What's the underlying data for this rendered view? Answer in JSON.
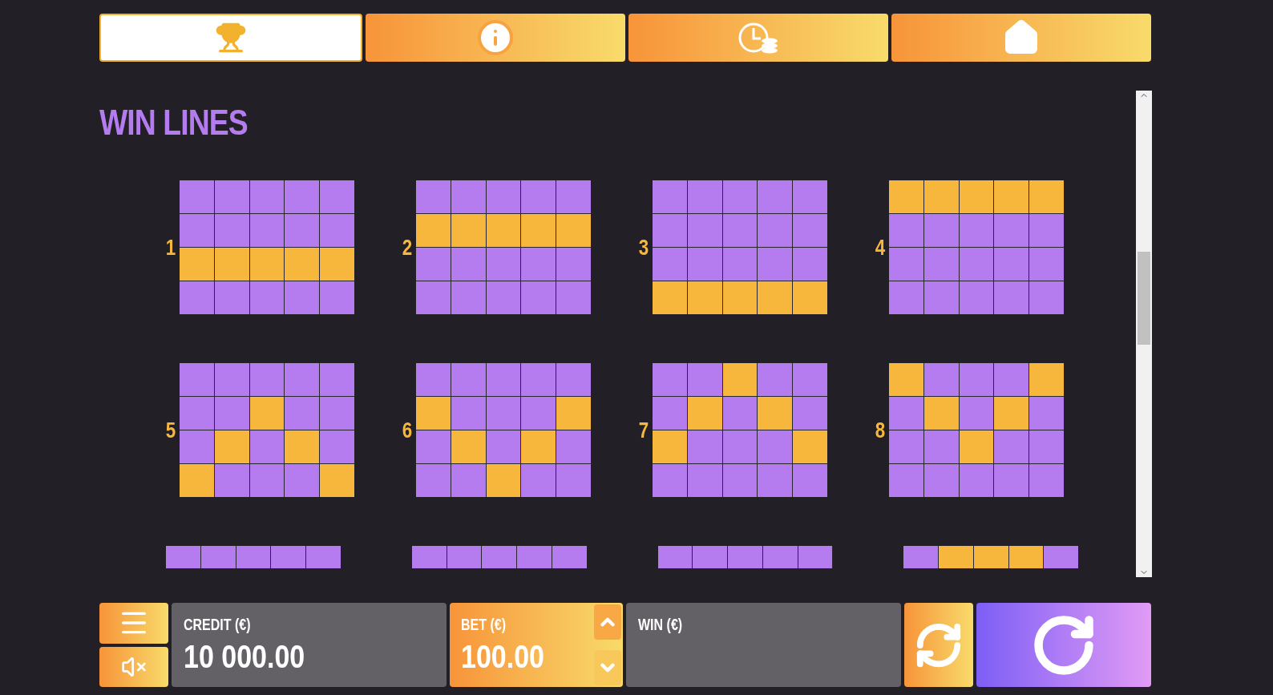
{
  "tabs": [
    {
      "kind": "trophy",
      "selected": true
    },
    {
      "kind": "info",
      "selected": false
    },
    {
      "kind": "history",
      "selected": false
    },
    {
      "kind": "home",
      "selected": false
    }
  ],
  "title": "WIN LINES",
  "lines": [
    {
      "number": "1",
      "cells": [
        [
          false,
          false,
          false,
          false,
          false
        ],
        [
          false,
          false,
          false,
          false,
          false
        ],
        [
          true,
          true,
          true,
          true,
          true
        ],
        [
          false,
          false,
          false,
          false,
          false
        ]
      ]
    },
    {
      "number": "2",
      "cells": [
        [
          false,
          false,
          false,
          false,
          false
        ],
        [
          true,
          true,
          true,
          true,
          true
        ],
        [
          false,
          false,
          false,
          false,
          false
        ],
        [
          false,
          false,
          false,
          false,
          false
        ]
      ]
    },
    {
      "number": "3",
      "cells": [
        [
          false,
          false,
          false,
          false,
          false
        ],
        [
          false,
          false,
          false,
          false,
          false
        ],
        [
          false,
          false,
          false,
          false,
          false
        ],
        [
          true,
          true,
          true,
          true,
          true
        ]
      ]
    },
    {
      "number": "4",
      "cells": [
        [
          true,
          true,
          true,
          true,
          true
        ],
        [
          false,
          false,
          false,
          false,
          false
        ],
        [
          false,
          false,
          false,
          false,
          false
        ],
        [
          false,
          false,
          false,
          false,
          false
        ]
      ]
    },
    {
      "number": "5",
      "cells": [
        [
          false,
          false,
          false,
          false,
          false
        ],
        [
          false,
          false,
          true,
          false,
          false
        ],
        [
          false,
          true,
          false,
          true,
          false
        ],
        [
          true,
          false,
          false,
          false,
          true
        ]
      ]
    },
    {
      "number": "6",
      "cells": [
        [
          false,
          false,
          false,
          false,
          false
        ],
        [
          true,
          false,
          false,
          false,
          true
        ],
        [
          false,
          true,
          false,
          true,
          false
        ],
        [
          false,
          false,
          true,
          false,
          false
        ]
      ]
    },
    {
      "number": "7",
      "cells": [
        [
          false,
          false,
          true,
          false,
          false
        ],
        [
          false,
          true,
          false,
          true,
          false
        ],
        [
          true,
          false,
          false,
          false,
          true
        ],
        [
          false,
          false,
          false,
          false,
          false
        ]
      ]
    },
    {
      "number": "8",
      "cells": [
        [
          true,
          false,
          false,
          false,
          true
        ],
        [
          false,
          true,
          false,
          true,
          false
        ],
        [
          false,
          false,
          true,
          false,
          false
        ],
        [
          false,
          false,
          false,
          false,
          false
        ]
      ]
    }
  ],
  "partial_lines": [
    {
      "cells": [
        [
          false,
          false,
          false,
          false,
          false
        ]
      ]
    },
    {
      "cells": [
        [
          false,
          false,
          false,
          false,
          false
        ]
      ]
    },
    {
      "cells": [
        [
          false,
          false,
          false,
          false,
          false
        ]
      ]
    },
    {
      "cells": [
        [
          false,
          true,
          true,
          true,
          false
        ]
      ]
    }
  ],
  "credit": {
    "label": "CREDIT (€)",
    "value": "10 000.00"
  },
  "bet": {
    "label": "BET (€)",
    "value": "100.00"
  },
  "win": {
    "label": "WIN (€)"
  }
}
